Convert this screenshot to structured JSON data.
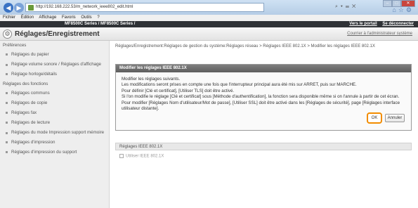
{
  "browser": {
    "url": "http://192.168.222.53/m_network_ieee802_edit.html",
    "tools": "⌕ ▾ ☰ ✕"
  },
  "menu": [
    "Fichier",
    "Édition",
    "Affichage",
    "Favoris",
    "Outils",
    "?"
  ],
  "device": {
    "model": "MF8500C Series / MF8500C Series /",
    "portal_link": "Vers le portail",
    "logout_link": "Se déconnecter"
  },
  "page": {
    "title": "Réglages/Enregistrement",
    "admin_contact": "Courrier à l'administrateur système"
  },
  "sidebar": {
    "heading1": "Préférences",
    "items1": [
      "Réglages du papier",
      "Réglage volume sonore / Réglages d'affichage",
      "Réglage horloge/détails"
    ],
    "heading2": "Réglages des fonctions",
    "items2": [
      "Réglages communs",
      "Réglages de copie",
      "Réglages fax",
      "Réglages de lecture",
      "Réglages du mode Impression support mémoire",
      "Réglages d'impression",
      "Réglages d'impression du support"
    ]
  },
  "breadcrumb": "Réglages/Enregistrement:Réglages de gestion du système:Réglages réseau > Réglages IEEE 802.1X > Modifier les réglages IEEE 802.1X",
  "dialog": {
    "title": "Modifier les réglages IEEE 802.1X",
    "lines": [
      "Modifier les réglages suivants.",
      "Les modifications seront prises en compte une fois que l'interrupteur principal aura été mis sur ARRET, puis sur MARCHE.",
      "Pour définir [Clé et certificat], [Utiliser TLS] doit être activé.",
      "Si l'on modifie le réglage [Clé et certificat] sous [Méthode d'authentification], la fonction sera disponible même si on l'annule à partir de cet écran.",
      "Pour modifier [Réglages Nom d'utilisateur/Mot de passe], [Utiliser SSL] doit être activé dans les [Réglages de sécurité], page [Réglages interface utilisateur distante]."
    ],
    "ok_label": "OK",
    "cancel_label": "Annuler"
  },
  "section": {
    "title": "Réglages IEEE 802.1X",
    "checkbox_label": "Utiliser IEEE 802.1X"
  },
  "colors": {
    "highlight": "#f28c00",
    "device_bar": "#2f3236"
  }
}
